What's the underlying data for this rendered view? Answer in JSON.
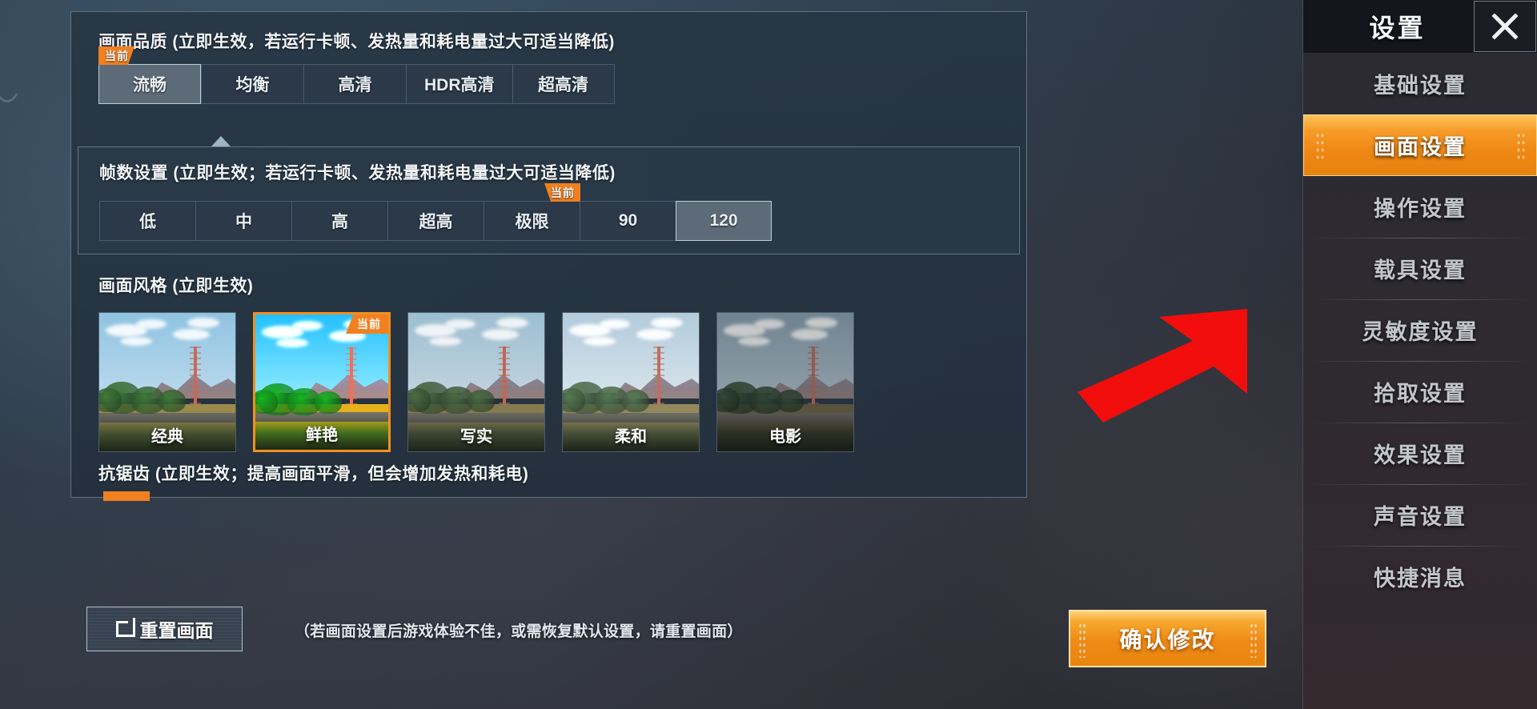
{
  "sidebar": {
    "title": "设置",
    "close_icon": "close-icon",
    "items": [
      {
        "label": "基础设置",
        "active": false
      },
      {
        "label": "画面设置",
        "active": true
      },
      {
        "label": "操作设置",
        "active": false
      },
      {
        "label": "载具设置",
        "active": false
      },
      {
        "label": "灵敏度设置",
        "active": false
      },
      {
        "label": "拾取设置",
        "active": false
      },
      {
        "label": "效果设置",
        "active": false
      },
      {
        "label": "声音设置",
        "active": false
      },
      {
        "label": "快捷消息",
        "active": false
      }
    ]
  },
  "quality": {
    "title": "画面品质 (立即生效，若运行卡顿、发热量和耗电量过大可适当降低)",
    "current_badge": "当前",
    "options": [
      {
        "label": "流畅",
        "selected": true,
        "current": true
      },
      {
        "label": "均衡",
        "selected": false,
        "current": false
      },
      {
        "label": "高清",
        "selected": false,
        "current": false
      },
      {
        "label": "HDR高清",
        "selected": false,
        "current": false
      },
      {
        "label": "超高清",
        "selected": false,
        "current": false
      }
    ]
  },
  "framerate": {
    "title": "帧数设置 (立即生效；若运行卡顿、发热量和耗电量过大可适当降低)",
    "current_badge": "当前",
    "options": [
      {
        "label": "低",
        "selected": false,
        "current": false
      },
      {
        "label": "中",
        "selected": false,
        "current": false
      },
      {
        "label": "高",
        "selected": false,
        "current": false
      },
      {
        "label": "超高",
        "selected": false,
        "current": false
      },
      {
        "label": "极限",
        "selected": false,
        "current": true
      },
      {
        "label": "90",
        "selected": false,
        "current": false
      },
      {
        "label": "120",
        "selected": true,
        "current": false
      }
    ]
  },
  "style": {
    "title": "画面风格 (立即生效)",
    "current_badge": "当前",
    "options": [
      {
        "label": "经典",
        "selected": false,
        "current": false
      },
      {
        "label": "鲜艳",
        "selected": true,
        "current": true
      },
      {
        "label": "写实",
        "selected": false,
        "current": false
      },
      {
        "label": "柔和",
        "selected": false,
        "current": false
      },
      {
        "label": "电影",
        "selected": false,
        "current": false
      }
    ]
  },
  "antialias": {
    "title": "抗锯齿 (立即生效；提高画面平滑，但会增加发热和耗电)"
  },
  "footer": {
    "reset_label": "重置画面",
    "reset_icon": "reset-icon",
    "hint": "（若画面设置后游戏体验不佳，或需恢复默认设置，请重置画面）",
    "confirm_label": "确认修改"
  },
  "annotation": {
    "arrow_color": "#f20d0d",
    "arrow_icon": "red-arrow-icon"
  },
  "colors": {
    "accent_orange": "#f08020",
    "panel_bg": "#2b3949",
    "sidebar_bg": "#2e2a30"
  }
}
